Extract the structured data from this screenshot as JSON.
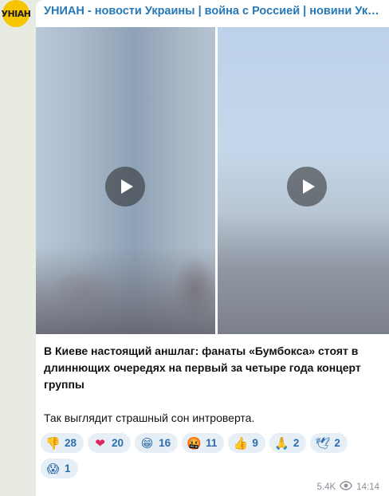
{
  "channel": {
    "avatar_text": "УНІАН",
    "title": "УНИАН - новости Украины | война с Россией | новини України | війна з Росією"
  },
  "media": {
    "videos": [
      {
        "icon": "play-icon"
      },
      {
        "icon": "play-icon"
      }
    ]
  },
  "post": {
    "bold_text": "В Киеве настоящий аншлаг: фанаты «Бумбокса» стоят в длиннющих очередях на первый за четыре года концерт группы",
    "text": "Так выглядит страшный сон интроверта."
  },
  "reactions": [
    {
      "emoji": "👎",
      "icon": "thumbs-down-icon",
      "count": "28"
    },
    {
      "emoji": "❤",
      "icon": "heart-icon",
      "count": "20"
    },
    {
      "emoji": "😁",
      "icon": "grinning-face-icon",
      "count": "16"
    },
    {
      "emoji": "🤬",
      "icon": "cursing-face-icon",
      "count": "11"
    },
    {
      "emoji": "👍",
      "icon": "thumbs-up-icon",
      "count": "9"
    },
    {
      "emoji": "🙏",
      "icon": "folded-hands-icon",
      "count": "2"
    },
    {
      "emoji": "🕊",
      "icon": "dove-icon",
      "count": "2"
    },
    {
      "emoji": "😱",
      "icon": "screaming-face-icon",
      "count": "1"
    }
  ],
  "meta": {
    "views": "5.4K",
    "time": "14:14",
    "views_icon": "eye-icon"
  },
  "colors": {
    "accent": "#2678b6",
    "reaction_bg": "#e6eef6",
    "avatar_bg": "#f6c500",
    "background": "#e7ebe2"
  }
}
